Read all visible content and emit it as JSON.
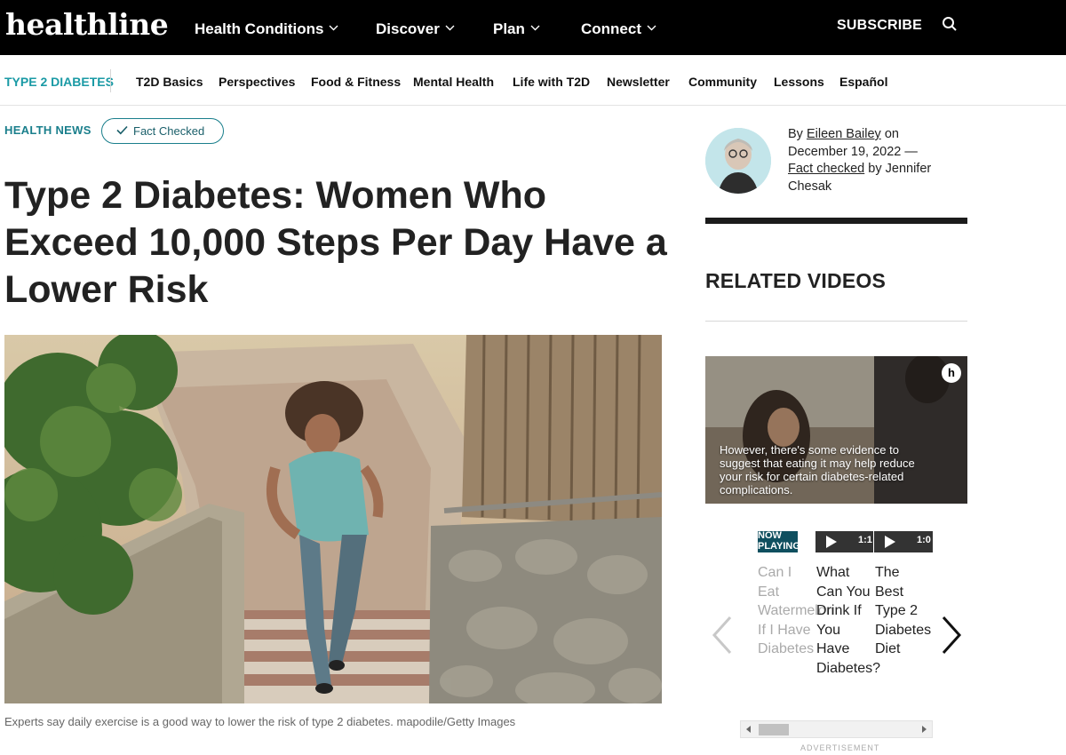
{
  "header": {
    "logo": "healthline",
    "nav": [
      "Health Conditions",
      "Discover",
      "Plan",
      "Connect"
    ],
    "subscribe": "SUBSCRIBE"
  },
  "subnav": {
    "brand": "TYPE 2 DIABETES",
    "items": [
      "T2D Basics",
      "Perspectives",
      "Food & Fitness",
      "Mental Health",
      "Life with T2D",
      "Newsletter",
      "Community",
      "Lessons",
      "Español"
    ]
  },
  "article": {
    "kicker": "HEALTH NEWS",
    "fact_checked": "Fact Checked",
    "headline": "Type 2 Diabetes: Women Who Exceed 10,000 Steps Per Day Have a Lower Risk",
    "caption": "Experts say daily exercise is a good way to lower the risk of type 2 diabetes. mapodile/Getty Images"
  },
  "byline": {
    "by": "By",
    "author": "Eileen Bailey",
    "on": "on",
    "date": "December 19, 2022",
    "dash": "—",
    "fact_checked": "Fact checked",
    "by2": "by Jennifer Chesak"
  },
  "related": {
    "title": "RELATED VIDEOS",
    "video_caption": "However, there's some evidence to suggest that eating it may help reduce your risk for certain diabetes-related complications.",
    "video_badge": "h",
    "thumbs": [
      {
        "label": "NOW PLAYING"
      },
      {
        "label": "1:1"
      },
      {
        "label": "1:0"
      }
    ],
    "cards": [
      "Can I Eat Watermelon If I Have Diabetes",
      "What Can You Drink If You Have Diabetes?",
      "The Best Type 2 Diabetes Diet"
    ],
    "advertisement": "ADVERTISEMENT"
  },
  "colors": {
    "teal": "#1a9aa5",
    "topbar": "#000000"
  }
}
